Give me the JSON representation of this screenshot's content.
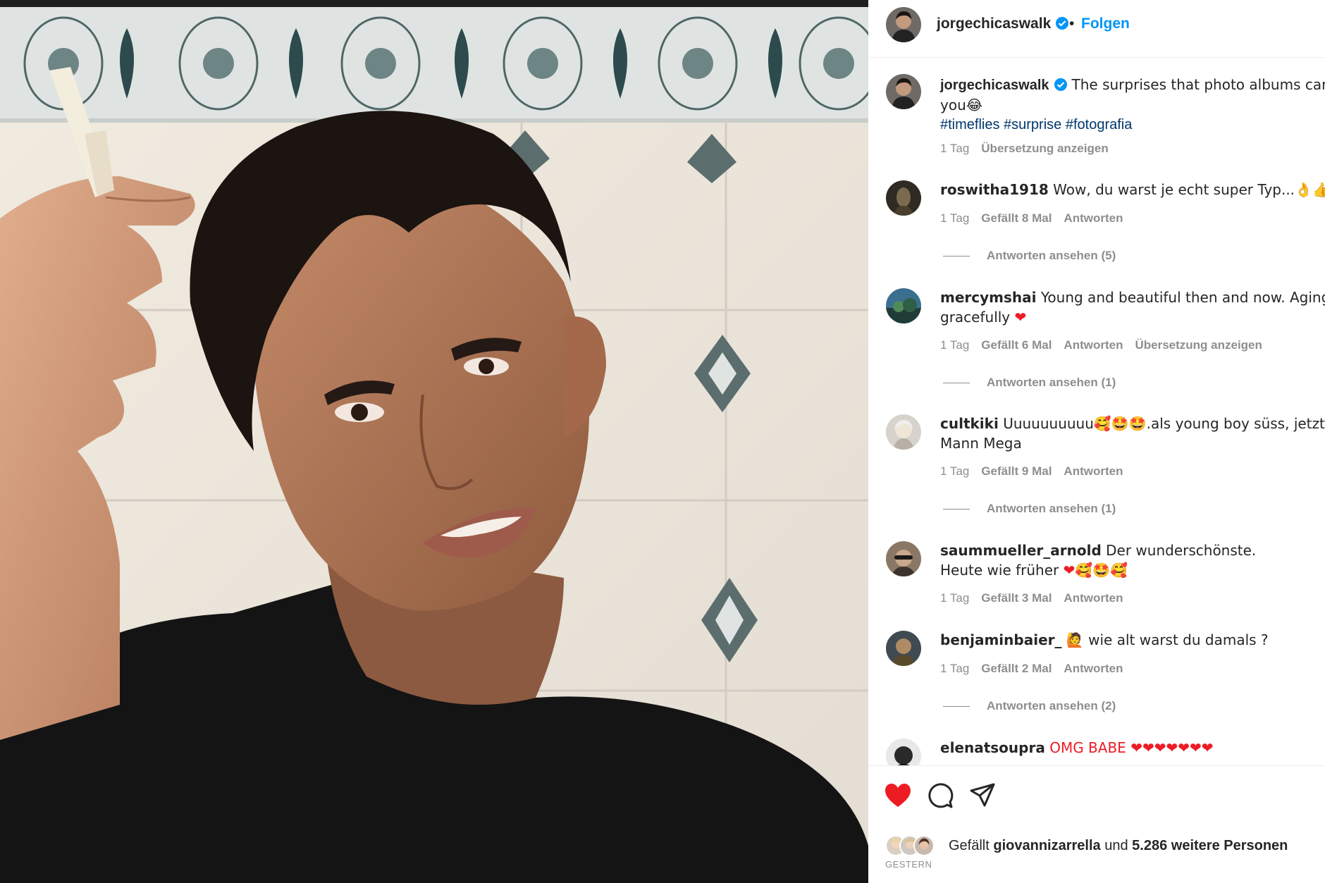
{
  "header": {
    "username": "jorgechicaswalk",
    "separator": "•",
    "follow_label": "Folgen"
  },
  "caption": {
    "username": "jorgechicaswalk",
    "text_line1": "The surprises that photo albums can ho",
    "text_line2": "you😂",
    "hashtags": "#timeflies #surprise #fotografia",
    "time": "1 Tag",
    "translate": "Übersetzung anzeigen"
  },
  "comments": [
    {
      "username": "roswitha1918",
      "line1": "Wow, du warst je echt super Typ...👌👍🙂",
      "line2": "",
      "time": "1 Tag",
      "likes": "Gefällt 8 Mal",
      "reply": "Antworten",
      "translate": "",
      "view_replies": "Antworten ansehen (5)"
    },
    {
      "username": "mercymshai",
      "line1": "Young and beautiful then and now. Aging",
      "line2": "gracefully ❤",
      "time": "1 Tag",
      "likes": "Gefällt 6 Mal",
      "reply": "Antworten",
      "translate": "Übersetzung anzeigen",
      "view_replies": "Antworten ansehen (1)"
    },
    {
      "username": "cultkiki",
      "line1": "Uuuuuuuuuu🥰🤩🤩.als young boy süss, jetzt als",
      "line2": "Mann Mega",
      "time": "1 Tag",
      "likes": "Gefällt 9 Mal",
      "reply": "Antworten",
      "translate": "",
      "view_replies": "Antworten ansehen (1)"
    },
    {
      "username": "saummueller_arnold",
      "line1": "Der wunderschönste.",
      "line2": "Heute wie früher ❤🥰🤩🥰",
      "time": "1 Tag",
      "likes": "Gefällt 3 Mal",
      "reply": "Antworten",
      "translate": "",
      "view_replies": ""
    },
    {
      "username": "benjaminbaier_",
      "line1": "🙋 wie alt warst du damals ?",
      "line2": "",
      "time": "1 Tag",
      "likes": "Gefällt 2 Mal",
      "reply": "Antworten",
      "translate": "",
      "view_replies": "Antworten ansehen (2)"
    },
    {
      "username": "elenatsoupra",
      "line1": "OMG BABE ❤❤❤❤❤❤❤",
      "line2": "",
      "time": "",
      "likes": "",
      "reply": "",
      "translate": "",
      "view_replies": ""
    }
  ],
  "actions": {
    "like_icon": "heart-filled-icon",
    "comment_icon": "comment-icon",
    "share_icon": "share-icon"
  },
  "likes": {
    "prefix": "Gefällt",
    "user": "giovannizarrella",
    "middle": "und",
    "count": "5.286 weitere Personen"
  },
  "date": "GESTERN",
  "colors": {
    "accent": "#0095f6",
    "like": "#ed1c24",
    "muted": "#8e8e8e",
    "hashtag": "#00376b"
  }
}
